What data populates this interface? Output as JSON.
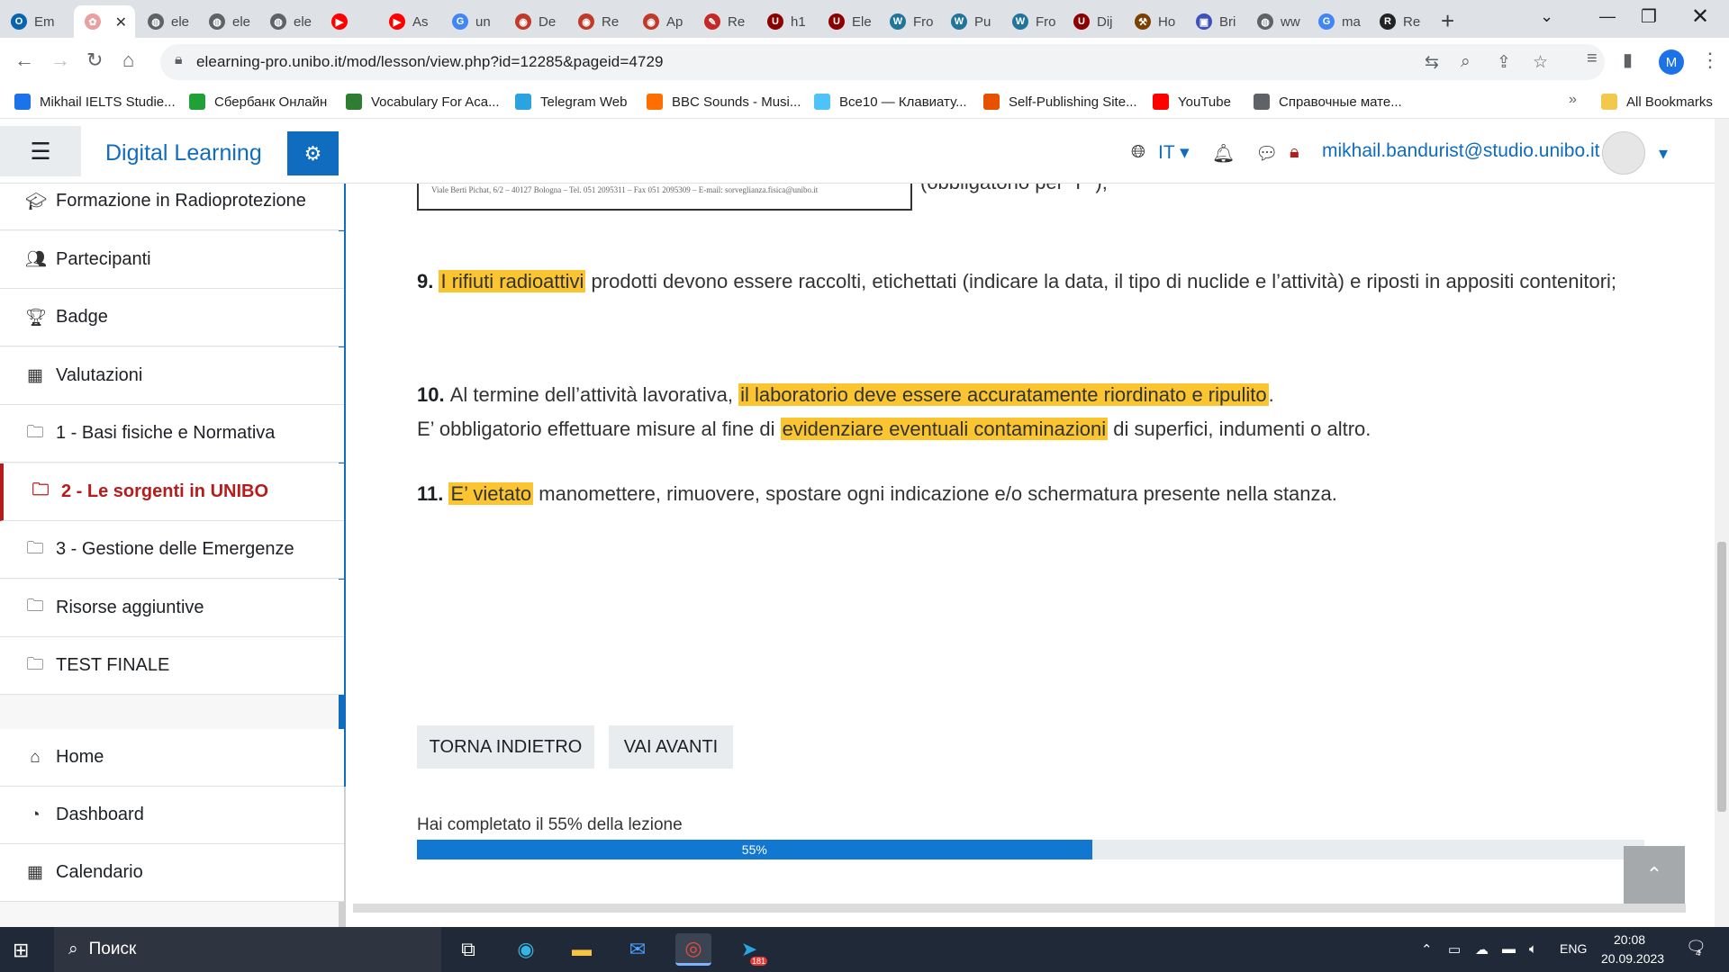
{
  "browser": {
    "tabs": [
      {
        "label": "Em",
        "icon": "outlook-icon",
        "color": "#0a64ad"
      },
      {
        "label": "",
        "icon": "unibo-flower-icon",
        "color": "#e8a0a0",
        "active": true
      },
      {
        "label": "ele",
        "icon": "globe-icon",
        "color": "#5f6368"
      },
      {
        "label": "ele",
        "icon": "globe-icon",
        "color": "#5f6368"
      },
      {
        "label": "ele",
        "icon": "globe-icon",
        "color": "#5f6368"
      },
      {
        "label": "",
        "icon": "youtube-icon",
        "color": "#ff0000"
      },
      {
        "label": "As",
        "icon": "youtube-icon",
        "color": "#ff0000"
      },
      {
        "label": "un",
        "icon": "google-icon",
        "color": "#4285f4"
      },
      {
        "label": "De",
        "icon": "unibo-icon",
        "color": "#c0392b"
      },
      {
        "label": "Re",
        "icon": "unibo-icon",
        "color": "#c0392b"
      },
      {
        "label": "Ap",
        "icon": "unibo-icon",
        "color": "#c0392b"
      },
      {
        "label": "Re",
        "icon": "puzzle-icon",
        "color": "#c62828"
      },
      {
        "label": "h1",
        "icon": "shield-icon",
        "color": "#8b0000"
      },
      {
        "label": "Ele",
        "icon": "shield-icon",
        "color": "#8b0000"
      },
      {
        "label": "Fro",
        "icon": "wordpress-icon",
        "color": "#21759b"
      },
      {
        "label": "Pu",
        "icon": "wordpress-icon",
        "color": "#21759b"
      },
      {
        "label": "Fro",
        "icon": "wordpress-icon",
        "color": "#21759b"
      },
      {
        "label": "Dij",
        "icon": "shield-icon",
        "color": "#8b0000"
      },
      {
        "label": "Ho",
        "icon": "hammer-icon",
        "color": "#7b3f00"
      },
      {
        "label": "Bri",
        "icon": "image-icon",
        "color": "#3f51b5"
      },
      {
        "label": "ww",
        "icon": "globe-icon",
        "color": "#5f6368"
      },
      {
        "label": "ma",
        "icon": "google-icon",
        "color": "#4285f4"
      },
      {
        "label": "Re",
        "icon": "r6-icon",
        "color": "#222222"
      }
    ],
    "url": "elearning-pro.unibo.it/mod/lesson/view.php?id=12285&pageid=4729",
    "profile_initial": "M",
    "bookmarks": [
      {
        "label": "Mikhail IELTS Studie...",
        "color": "#1a73e8"
      },
      {
        "label": "Сбербанк Онлайн",
        "color": "#21a038"
      },
      {
        "label": "Vocabulary For Aca...",
        "color": "#2e7d32"
      },
      {
        "label": "Telegram Web",
        "color": "#2aa3df"
      },
      {
        "label": "BBC Sounds - Musi...",
        "color": "#ff6f00"
      },
      {
        "label": "Все10 — Клавиату...",
        "color": "#4fc3f7"
      },
      {
        "label": "Self-Publishing Site...",
        "color": "#e65100"
      },
      {
        "label": "YouTube",
        "color": "#ff0000"
      },
      {
        "label": "Справочные мате...",
        "color": "#5f6368"
      }
    ],
    "all_bookmarks": "All Bookmarks",
    "more_chevron": "»"
  },
  "header": {
    "brand": "Digital Learning",
    "language": "IT",
    "user_email": "mikhail.bandurist@studio.unibo.it"
  },
  "sidebar": {
    "course_items": [
      {
        "label": "Formazione in Radioprotezione",
        "icon": "graduation-cap-icon"
      },
      {
        "label": "Partecipanti",
        "icon": "users-icon"
      },
      {
        "label": "Badge",
        "icon": "trophy-icon"
      },
      {
        "label": "Valutazioni",
        "icon": "table-icon"
      },
      {
        "label": "1 - Basi fisiche e Normativa",
        "icon": "folder-icon"
      },
      {
        "label": "2 - Le sorgenti in UNIBO",
        "icon": "folder-icon",
        "active": true
      },
      {
        "label": "3 - Gestione delle Emergenze",
        "icon": "folder-icon"
      },
      {
        "label": "Risorse aggiuntive",
        "icon": "folder-icon"
      },
      {
        "label": "TEST FINALE",
        "icon": "folder-icon"
      }
    ],
    "site_items": [
      {
        "label": "Home",
        "icon": "home-icon"
      },
      {
        "label": "Dashboard",
        "icon": "dashboard-icon"
      },
      {
        "label": "Calendario",
        "icon": "calendar-icon"
      }
    ]
  },
  "content": {
    "image_caption": "(obbligatorio per “P”);",
    "image_tiny_text": "Viale Berti Pichat, 6/2 – 40127 Bologna – Tel. 051 2095311 – Fax 051 2095309 – E-mail: sorveglianza.fisica@unibo.it",
    "rules": [
      {
        "number": "9.",
        "parts": [
          {
            "text": "I rifiuti radioattivi",
            "highlight": true
          },
          {
            "text": " prodotti devono essere raccolti, etichettati (indicare la data, il tipo di nuclide e l’attività) e riposti in appositi contenitori;",
            "highlight": false
          }
        ]
      },
      {
        "number": "10.",
        "parts": [
          {
            "text": "Al termine dell’attività lavorativa, ",
            "highlight": false
          },
          {
            "text": "il laboratorio deve essere accuratamente riordinato e ripulito",
            "highlight": true
          },
          {
            "text": ".",
            "highlight": false
          }
        ],
        "line2": [
          {
            "text": "E’ obbligatorio effettuare misure al fine di ",
            "highlight": false
          },
          {
            "text": "evidenziare eventuali contaminazioni",
            "highlight": true
          },
          {
            "text": " di superfici, indumenti o altro.",
            "highlight": false
          }
        ]
      },
      {
        "number": "11.",
        "parts": [
          {
            "text": "E’ vietato",
            "highlight": true
          },
          {
            "text": " manomettere, rimuovere, spostare ogni indicazione e/o schermatura presente nella stanza.",
            "highlight": false
          }
        ]
      }
    ],
    "back_button": "TORNA INDIETRO",
    "next_button": "VAI AVANTI",
    "progress_text": "Hai completato il 55% della lezione",
    "progress_percent": 55,
    "progress_label": "55%",
    "highlight_color": "#fbc531"
  },
  "taskbar": {
    "search_placeholder": "Поиск",
    "language": "ENG",
    "time": "20:08",
    "date": "20.09.2023",
    "telegram_badge": "181",
    "notification_count": "4"
  }
}
